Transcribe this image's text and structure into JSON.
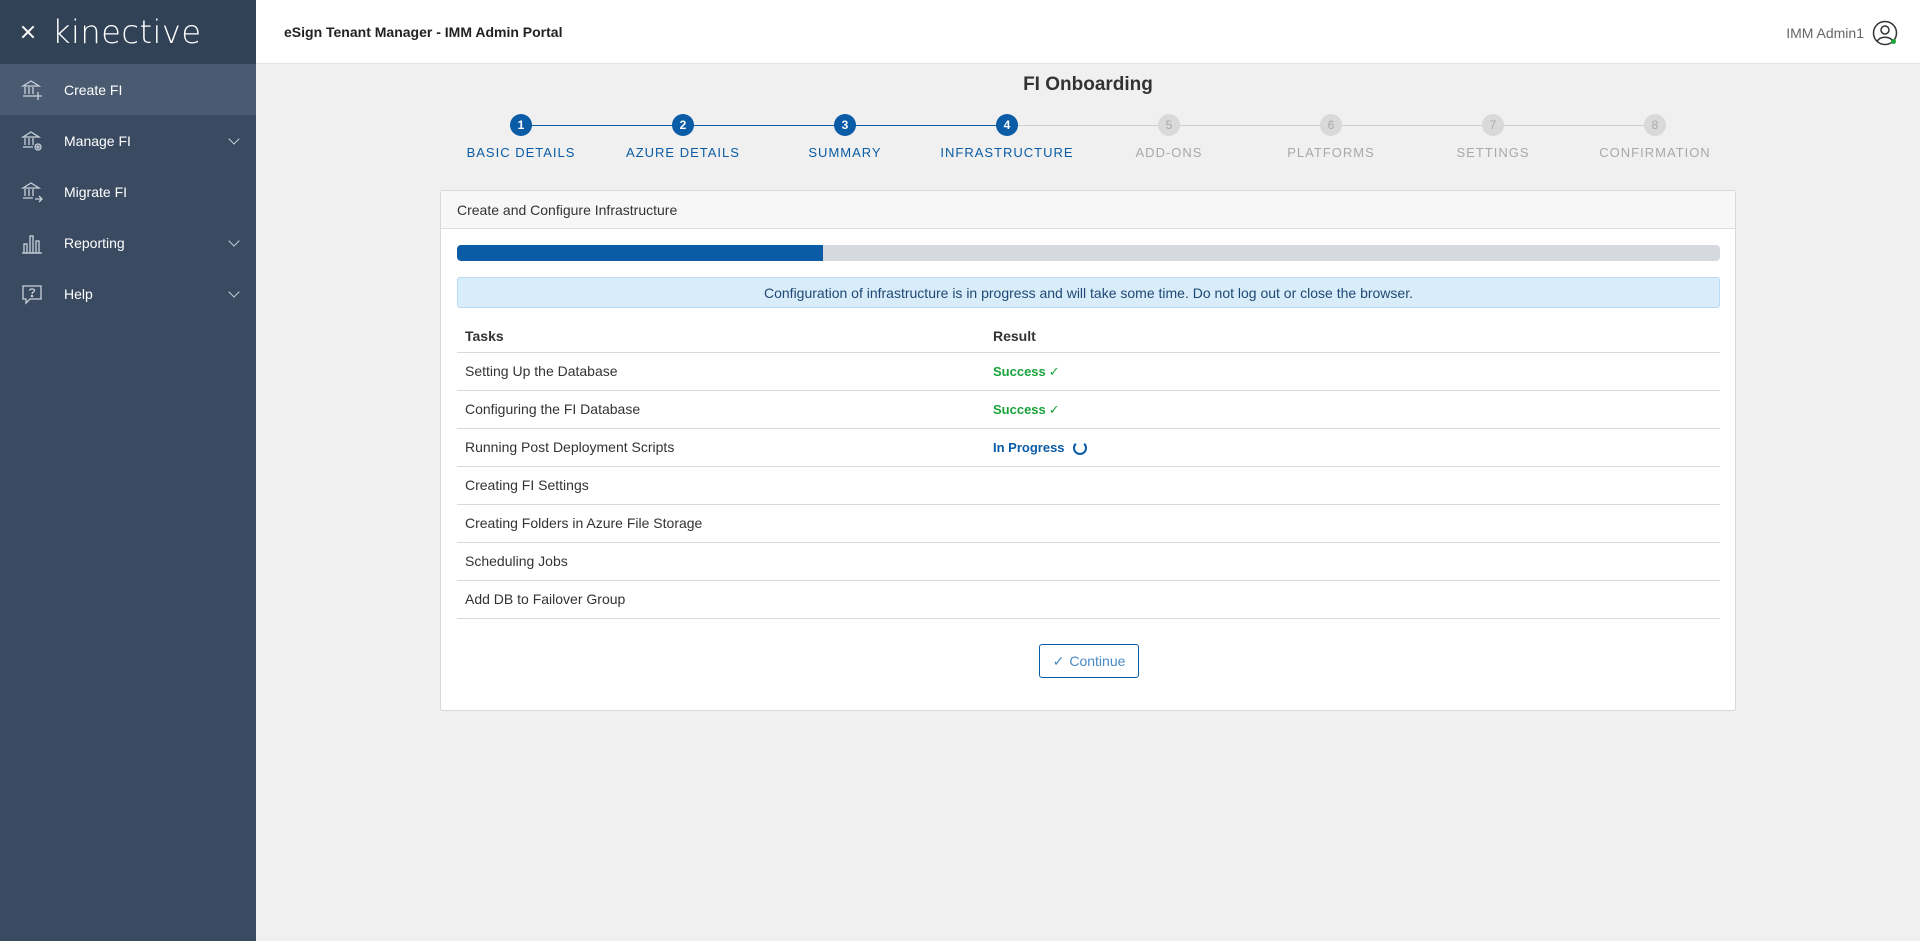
{
  "brand": {
    "logo_text": "kinective"
  },
  "sidebar": {
    "items": [
      {
        "label": "Create FI",
        "icon": "bank-add-icon",
        "active": true,
        "has_submenu": false
      },
      {
        "label": "Manage FI",
        "icon": "bank-gear-icon",
        "active": false,
        "has_submenu": true
      },
      {
        "label": "Migrate FI",
        "icon": "bank-migrate-icon",
        "active": false,
        "has_submenu": false
      },
      {
        "label": "Reporting",
        "icon": "bar-chart-icon",
        "active": false,
        "has_submenu": true
      },
      {
        "label": "Help",
        "icon": "help-icon",
        "active": false,
        "has_submenu": true
      }
    ]
  },
  "header": {
    "title": "eSign Tenant Manager - IMM Admin Portal",
    "user_name": "IMM Admin1"
  },
  "main": {
    "page_title": "FI Onboarding",
    "steps": [
      {
        "number": "1",
        "label": "BASIC DETAILS",
        "state": "done"
      },
      {
        "number": "2",
        "label": "AZURE DETAILS",
        "state": "done"
      },
      {
        "number": "3",
        "label": "SUMMARY",
        "state": "done"
      },
      {
        "number": "4",
        "label": "INFRASTRUCTURE",
        "state": "current"
      },
      {
        "number": "5",
        "label": "ADD-ONS",
        "state": "pending"
      },
      {
        "number": "6",
        "label": "PLATFORMS",
        "state": "pending"
      },
      {
        "number": "7",
        "label": "SETTINGS",
        "state": "pending"
      },
      {
        "number": "8",
        "label": "CONFIRMATION",
        "state": "pending"
      }
    ],
    "card": {
      "title": "Create and Configure Infrastructure",
      "progress_fraction": 0.29,
      "alert": "Configuration of infrastructure is in progress and will take some time. Do not log out or close the browser.",
      "table": {
        "headers": [
          "Tasks",
          "Result"
        ],
        "rows": [
          {
            "task": "Setting Up the Database",
            "result": "Success",
            "status": "success"
          },
          {
            "task": "Configuring the FI Database",
            "result": "Success",
            "status": "success"
          },
          {
            "task": "Running Post Deployment Scripts",
            "result": "In Progress",
            "status": "progress"
          },
          {
            "task": "Creating FI Settings",
            "result": "",
            "status": "none"
          },
          {
            "task": "Creating Folders in Azure File Storage",
            "result": "",
            "status": "none"
          },
          {
            "task": "Scheduling Jobs",
            "result": "",
            "status": "none"
          },
          {
            "task": "Add DB to Failover Group",
            "result": "",
            "status": "none"
          }
        ]
      },
      "continue_label": "Continue"
    }
  },
  "colors": {
    "sidebar_bg": "#3a4a60",
    "primary": "#0a5ca6",
    "success": "#1aa33a",
    "alert_bg": "#d9ecfa"
  }
}
